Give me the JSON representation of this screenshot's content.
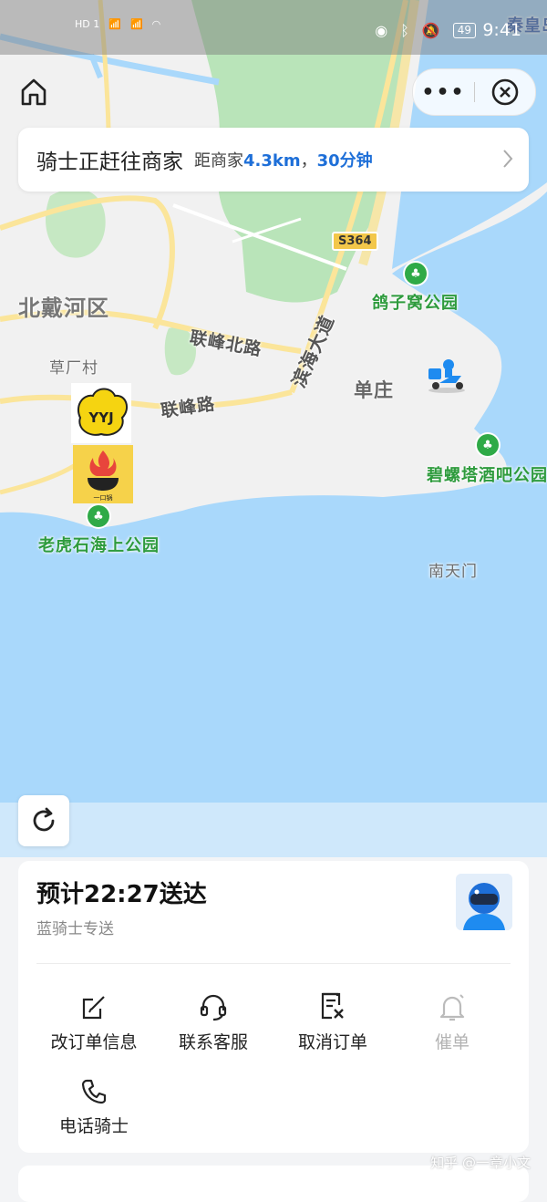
{
  "status_bar": {
    "time": "9:41",
    "battery": "49",
    "left_indicators": [
      "HD 1",
      "HD 2",
      "4G",
      "4G"
    ]
  },
  "status_card": {
    "title": "骑士正赶往商家",
    "distance_prefix": "距商家",
    "distance": "4.3km",
    "separator": "，",
    "eta_minutes": "30分钟"
  },
  "map": {
    "labels": {
      "district": "北戴河区",
      "village": "草厂村",
      "road1": "联峰北路",
      "road2": "联峰路",
      "road3": "滨海大道",
      "town": "单庄",
      "park1": "鸽子窝公园",
      "park2": "碧螺塔酒吧公园",
      "park3": "老虎石海上公园",
      "place": "南天门",
      "city": "秦皇岛",
      "highway": "S364"
    },
    "shop_logo_text": "YYJ",
    "shop2_logo_text": "一口锅"
  },
  "delivery": {
    "eta": "预计22:27送达",
    "rider_type": "蓝骑士专送"
  },
  "actions": [
    {
      "label": "改订单信息",
      "icon": "edit-icon"
    },
    {
      "label": "联系客服",
      "icon": "headset-icon"
    },
    {
      "label": "取消订单",
      "icon": "cancel-order-icon"
    },
    {
      "label": "催单",
      "icon": "bell-icon",
      "disabled": true
    },
    {
      "label": "电话骑士",
      "icon": "phone-icon"
    }
  ],
  "watermark": "知乎 @一章小文",
  "colors": {
    "accent": "#1e6fd8",
    "park_green": "#2e9b3d",
    "sea": "#a9d8fb",
    "land": "#f1f1f1"
  }
}
